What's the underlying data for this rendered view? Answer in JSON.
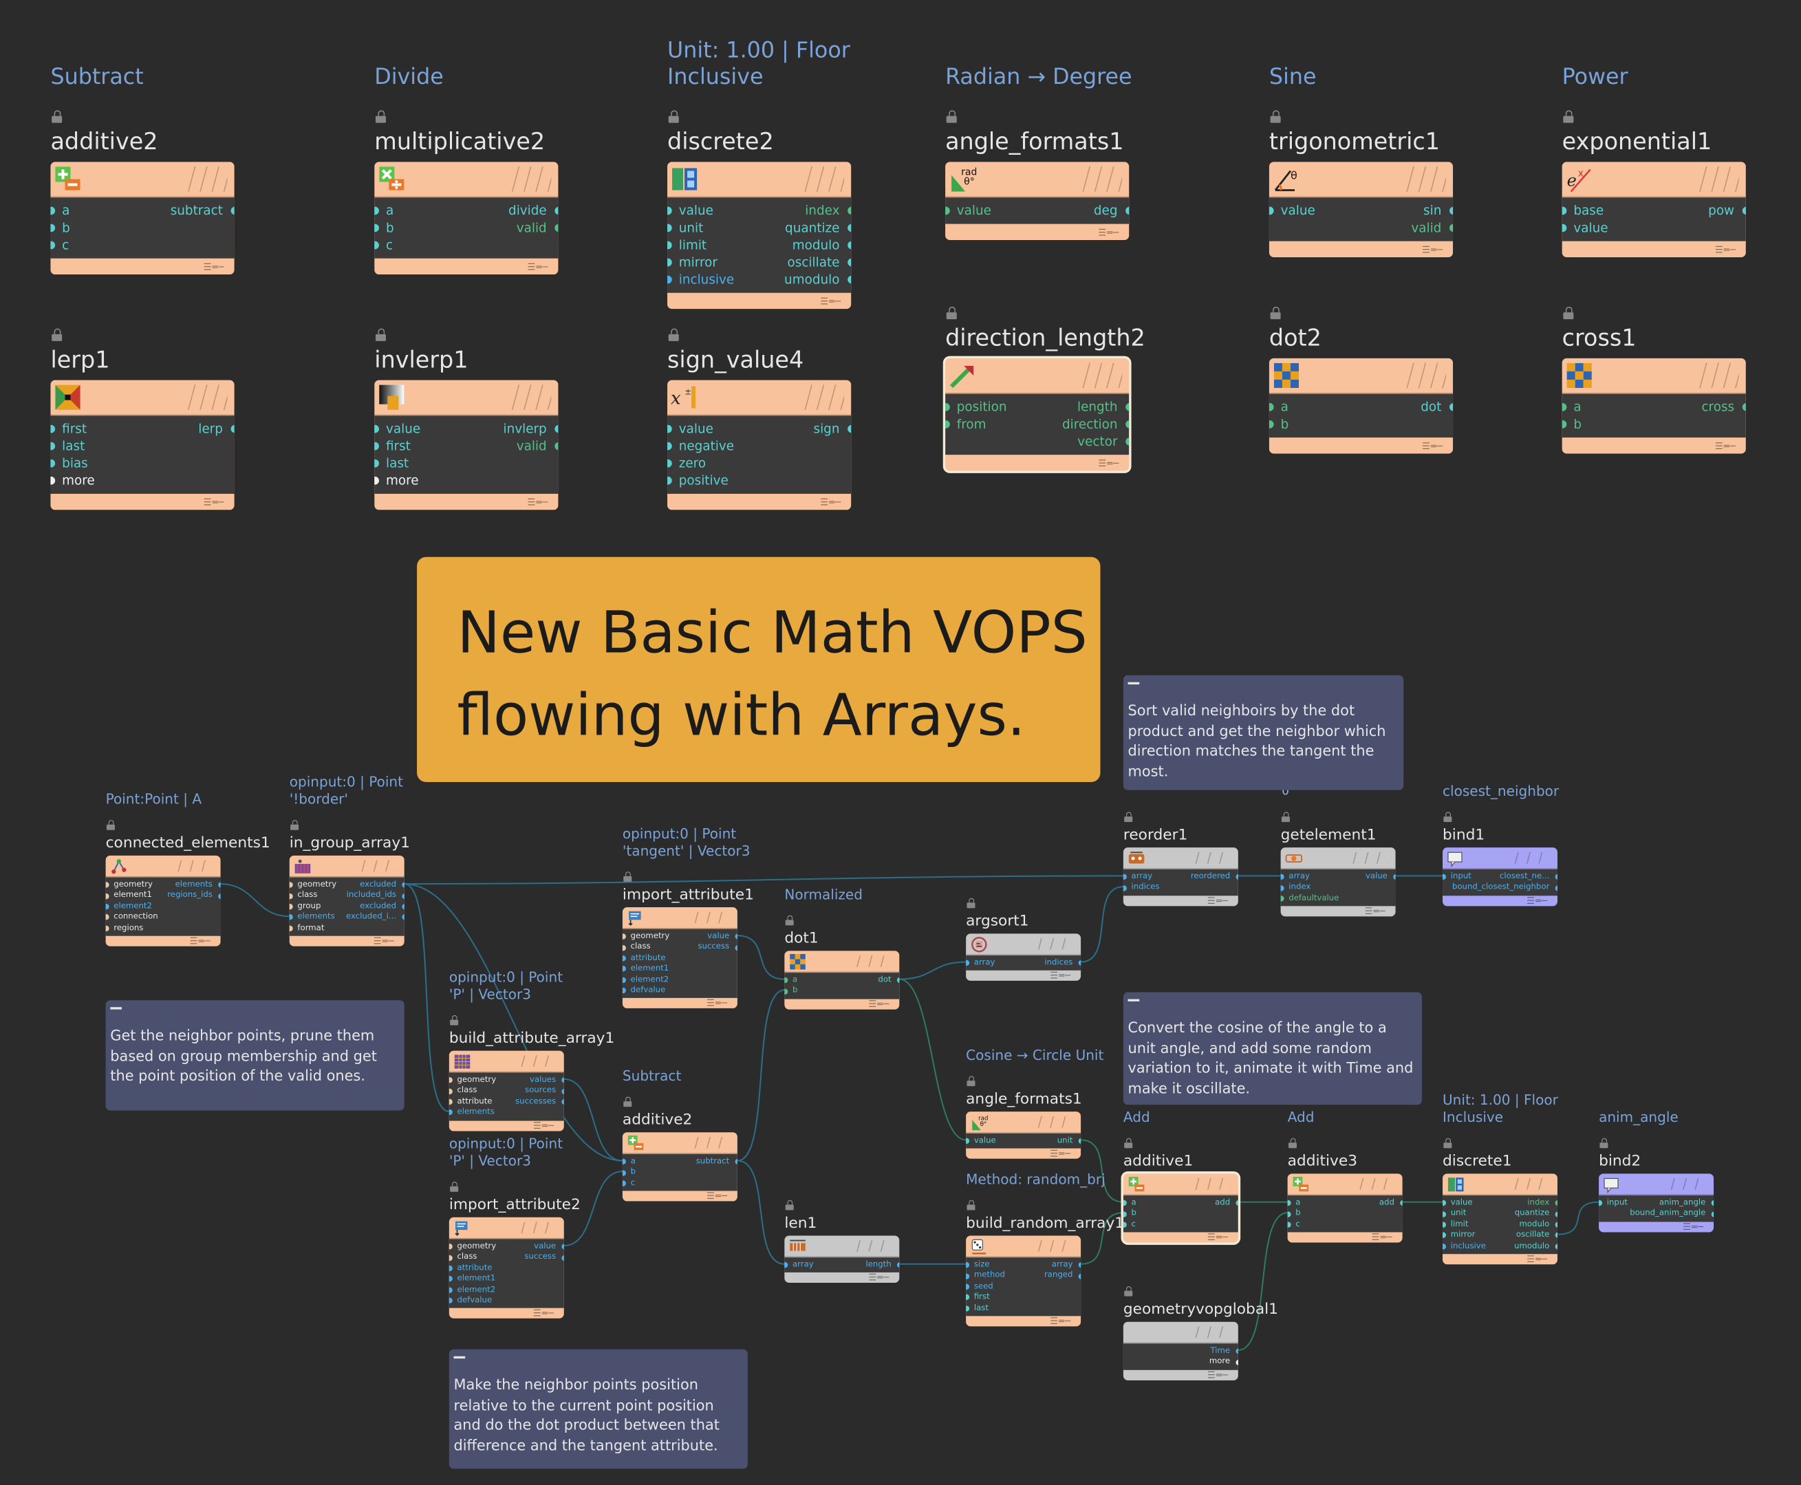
{
  "title": "New Basic Math VOPS flowing with Arrays.",
  "colors": {
    "background": "#2b2b2b",
    "node_orange": "#f8c39c",
    "node_body": "#3a3a3a",
    "node_gray": "#c8c8c8",
    "node_purple": "#a7a3f5",
    "banner": "#e8a93f",
    "sticky": "#4b506e",
    "comment_text": "#7aa3d9",
    "port_float": "#5ad0d0",
    "port_int": "#56c08a",
    "port_vector": "#4ab0f0",
    "port_string": "#e8c8a8",
    "port_more": "#f0f0f0",
    "wire": "#2c6e88"
  },
  "nodes": [
    {
      "id": "additive2_top",
      "name": "additive2",
      "comment": "Subtract",
      "icon": "plus-minus-icon",
      "inputs": [
        "a",
        "b",
        "c"
      ],
      "outputs": [
        "subtract"
      ]
    },
    {
      "id": "multiplicative2",
      "name": "multiplicative2",
      "comment": "Divide",
      "icon": "multiply-divide-icon",
      "inputs": [
        "a",
        "b",
        "c"
      ],
      "outputs": [
        "divide",
        "valid"
      ]
    },
    {
      "id": "discrete2",
      "name": "discrete2",
      "comment": "Unit: 1.00 | Floor\nInclusive",
      "icon": "discrete-icon",
      "inputs": [
        "value",
        "unit",
        "limit",
        "mirror",
        "inclusive"
      ],
      "outputs": [
        "index",
        "quantize",
        "modulo",
        "oscillate",
        "umodulo"
      ]
    },
    {
      "id": "angle_formats1_top",
      "name": "angle_formats1",
      "comment": "Radian → Degree",
      "icon": "rad-angle-icon",
      "inputs": [
        "value"
      ],
      "outputs": [
        "deg"
      ]
    },
    {
      "id": "trigonometric1",
      "name": "trigonometric1",
      "comment": "Sine",
      "icon": "trig-angle-icon",
      "inputs": [
        "value"
      ],
      "outputs": [
        "sin",
        "valid"
      ]
    },
    {
      "id": "exponential1",
      "name": "exponential1",
      "comment": "Power",
      "icon": "exponent-icon",
      "inputs": [
        "base",
        "value"
      ],
      "outputs": [
        "pow"
      ]
    },
    {
      "id": "lerp1",
      "name": "lerp1",
      "comment": "",
      "icon": "lerp-icon",
      "inputs": [
        "first",
        "last",
        "bias",
        "more"
      ],
      "outputs": [
        "lerp"
      ]
    },
    {
      "id": "invlerp1",
      "name": "invlerp1",
      "comment": "",
      "icon": "invlerp-icon",
      "inputs": [
        "value",
        "first",
        "last",
        "more"
      ],
      "outputs": [
        "invlerp",
        "valid"
      ]
    },
    {
      "id": "sign_value4",
      "name": "sign_value4",
      "comment": "",
      "icon": "sign-icon",
      "inputs": [
        "value",
        "negative",
        "zero",
        "positive"
      ],
      "outputs": [
        "sign"
      ]
    },
    {
      "id": "direction_length2",
      "name": "direction_length2",
      "comment": "",
      "icon": "direction-arrow-icon",
      "inputs": [
        "position",
        "from"
      ],
      "outputs": [
        "length",
        "direction",
        "vector"
      ]
    },
    {
      "id": "dot2",
      "name": "dot2",
      "comment": "",
      "icon": "dot-product-icon",
      "inputs": [
        "a",
        "b"
      ],
      "outputs": [
        "dot"
      ]
    },
    {
      "id": "cross1",
      "name": "cross1",
      "comment": "",
      "icon": "cross-product-icon",
      "inputs": [
        "a",
        "b"
      ],
      "outputs": [
        "cross"
      ]
    },
    {
      "id": "connected_elements1",
      "name": "connected_elements1",
      "comment": "Point:Point | A",
      "icon": "connected-graph-icon",
      "inputs": [
        "geometry",
        "element1",
        "element2",
        "connection",
        "regions"
      ],
      "outputs": [
        "elements",
        "regions_ids"
      ]
    },
    {
      "id": "in_group_array1",
      "name": "in_group_array1",
      "comment": "opinput:0 | Point\n'!border'",
      "icon": "group-array-icon",
      "inputs": [
        "geometry",
        "class",
        "group",
        "elements",
        "format"
      ],
      "outputs": [
        "excluded",
        "included_ids",
        "excluded",
        "excluded_i..."
      ]
    },
    {
      "id": "import_attribute1",
      "name": "import_attribute1",
      "comment": "opinput:0 | Point\n'tangent' | Vector3",
      "icon": "import-attribute-icon",
      "inputs": [
        "geometry",
        "class",
        "attribute",
        "element1",
        "element2",
        "defvalue"
      ],
      "outputs": [
        "value",
        "success"
      ]
    },
    {
      "id": "dot1",
      "name": "dot1",
      "comment": "Normalized",
      "icon": "dot-product-icon",
      "inputs": [
        "a",
        "b"
      ],
      "outputs": [
        "dot"
      ]
    },
    {
      "id": "argsort1",
      "name": "argsort1",
      "comment": "",
      "icon": "argsort-icon",
      "inputs": [
        "array"
      ],
      "outputs": [
        "indices"
      ]
    },
    {
      "id": "reorder1",
      "name": "reorder1",
      "comment": "",
      "icon": "reorder-icon",
      "inputs": [
        "array",
        "indices"
      ],
      "outputs": [
        "reordered"
      ]
    },
    {
      "id": "getelement1",
      "name": "getelement1",
      "comment": "0",
      "icon": "get-element-icon",
      "inputs": [
        "array",
        "index",
        "defaultvalue"
      ],
      "outputs": [
        "value"
      ]
    },
    {
      "id": "bind1",
      "name": "bind1",
      "comment": "closest_neighbor",
      "icon": "bind-export-icon",
      "inputs": [
        "input"
      ],
      "outputs": [
        "closest_ne...",
        "bound_closest_neighbor"
      ]
    },
    {
      "id": "build_attribute_array1",
      "name": "build_attribute_array1",
      "comment": "opinput:0 | Point\n'P' | Vector3",
      "icon": "attribute-array-icon",
      "inputs": [
        "geometry",
        "class",
        "attribute",
        "elements"
      ],
      "outputs": [
        "values",
        "sources",
        "successes"
      ]
    },
    {
      "id": "import_attribute2",
      "name": "import_attribute2",
      "comment": "opinput:0 | Point\n'P' | Vector3",
      "icon": "import-attribute-icon",
      "inputs": [
        "geometry",
        "class",
        "attribute",
        "element1",
        "element2",
        "defvalue"
      ],
      "outputs": [
        "value",
        "success"
      ]
    },
    {
      "id": "additive2_bottom",
      "name": "additive2",
      "comment": "Subtract",
      "icon": "plus-minus-icon",
      "inputs": [
        "a",
        "b",
        "c"
      ],
      "outputs": [
        "subtract"
      ]
    },
    {
      "id": "len1",
      "name": "len1",
      "comment": "",
      "icon": "array-length-icon",
      "inputs": [
        "array"
      ],
      "outputs": [
        "length"
      ]
    },
    {
      "id": "angle_formats1_bottom",
      "name": "angle_formats1",
      "comment": "Cosine → Circle Unit",
      "icon": "rad-angle-icon",
      "inputs": [
        "value"
      ],
      "outputs": [
        "unit"
      ]
    },
    {
      "id": "build_random_array1",
      "name": "build_random_array1",
      "comment": "Method: random_brj",
      "icon": "random-array-icon",
      "inputs": [
        "size",
        "method",
        "seed",
        "first",
        "last"
      ],
      "outputs": [
        "array",
        "ranged"
      ]
    },
    {
      "id": "additive1",
      "name": "additive1",
      "comment": "Add",
      "icon": "plus-minus-icon",
      "inputs": [
        "a",
        "b",
        "c"
      ],
      "outputs": [
        "add"
      ]
    },
    {
      "id": "additive3",
      "name": "additive3",
      "comment": "Add",
      "icon": "plus-minus-icon",
      "inputs": [
        "a",
        "b",
        "c"
      ],
      "outputs": [
        "add"
      ]
    },
    {
      "id": "discrete1",
      "name": "discrete1",
      "comment": "Unit: 1.00 | Floor\nInclusive",
      "icon": "discrete-icon",
      "inputs": [
        "value",
        "unit",
        "limit",
        "mirror",
        "inclusive"
      ],
      "outputs": [
        "index",
        "quantize",
        "modulo",
        "oscillate",
        "umodulo"
      ]
    },
    {
      "id": "bind2",
      "name": "bind2",
      "comment": "anim_angle",
      "icon": "bind-export-icon",
      "inputs": [
        "input"
      ],
      "outputs": [
        "anim_angle",
        "bound_anim_angle"
      ]
    },
    {
      "id": "geometryvopglobal1",
      "name": "geometryvopglobal1",
      "comment": "",
      "icon": "",
      "inputs": [],
      "outputs": [
        "Time",
        "more"
      ]
    }
  ],
  "stickies": [
    {
      "id": "sticky_sort",
      "text": "Sort valid neighboirs by the dot product and get the neighbor which direction matches the tangent the most."
    },
    {
      "id": "sticky_cosine",
      "text": "Convert the cosine of the angle to a unit angle, and add some random variation to it, animate it with Time and make it oscillate."
    },
    {
      "id": "sticky_neighbor",
      "text": "Get the neighbor points, prune them based on group membership and get the point position of the valid ones."
    },
    {
      "id": "sticky_relative",
      "text": "Make the neighbor points position relative to the current point position and do the dot product between that difference and the tangent attribute."
    }
  ]
}
